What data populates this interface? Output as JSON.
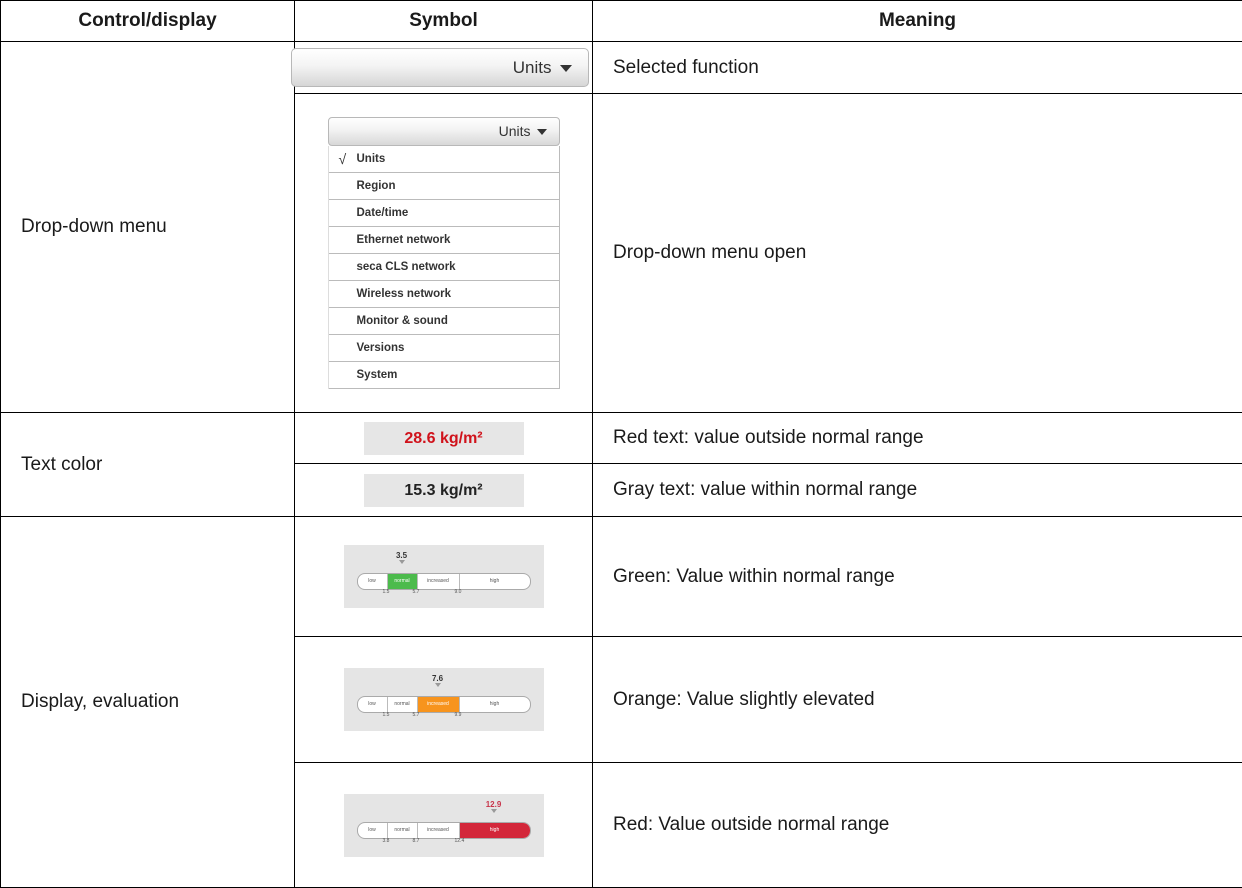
{
  "headers": {
    "control": "Control/display",
    "symbol": "Symbol",
    "meaning": "Meaning"
  },
  "dropdown": {
    "control": "Drop-down menu",
    "closed_label": "Units",
    "closed_meaning": "Selected function",
    "open_label": "Units",
    "open_meaning": "Drop-down menu open",
    "items": [
      "Units",
      "Region",
      "Date/time",
      "Ethernet network",
      "seca CLS network",
      "Wireless network",
      "Monitor & sound",
      "Versions",
      "System"
    ],
    "checked_index": 0
  },
  "text_color": {
    "control": "Text color",
    "red_value": "28.6 kg/m²",
    "red_meaning": "Red text: value outside normal range",
    "gray_value": "15.3 kg/m²",
    "gray_meaning": "Gray text: value within normal range",
    "red_color": "#d0121b"
  },
  "evaluation": {
    "control": "Display, evaluation",
    "gauges": [
      {
        "marker": "3.5",
        "segments": [
          "low",
          "normal",
          "increased",
          "high"
        ],
        "active_segment": 1,
        "active_color": "#4cbb4c",
        "ticks": [
          "1.5",
          "5.7",
          "9.0"
        ],
        "meaning": "Green: Value within normal range"
      },
      {
        "marker": "7.6",
        "segments": [
          "low",
          "normal",
          "increased",
          "high"
        ],
        "active_segment": 2,
        "active_color": "#f7941d",
        "ticks": [
          "1.5",
          "5.7",
          "9.9"
        ],
        "meaning": "Orange: Value slightly elevated"
      },
      {
        "marker": "12.9",
        "segments": [
          "low",
          "normal",
          "increased",
          "high"
        ],
        "active_segment": 3,
        "active_color": "#d3273a",
        "marker_color": "#c8344a",
        "ticks": [
          "3.8",
          "8.7",
          "12.4"
        ],
        "meaning": "Red: Value outside normal range"
      }
    ]
  }
}
